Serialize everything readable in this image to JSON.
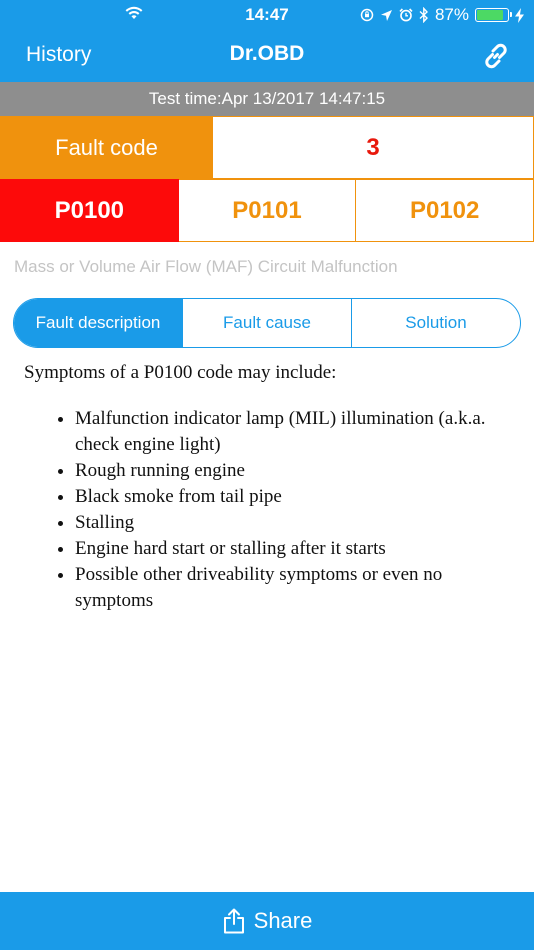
{
  "status_bar": {
    "time": "14:47",
    "battery_percent": "87%",
    "battery_level": 0.87,
    "icons": [
      "wifi-icon",
      "lock-rotation-icon",
      "location-icon",
      "alarm-icon",
      "bluetooth-icon",
      "battery-icon",
      "charging-icon"
    ]
  },
  "nav": {
    "back_label": "History",
    "title": "Dr.OBD",
    "link_icon": "link-icon"
  },
  "test_time": "Test time:Apr 13/2017 14:47:15",
  "fault": {
    "label": "Fault code",
    "count": "3",
    "codes": [
      "P0100",
      "P0101",
      "P0102"
    ],
    "selected_code": "P0100",
    "description_title": "Mass or Volume Air Flow (MAF) Circuit Malfunction"
  },
  "tabs": {
    "items": [
      "Fault description",
      "Fault cause",
      "Solution"
    ],
    "selected": "Fault description"
  },
  "content": {
    "intro": "Symptoms of a P0100 code may include:",
    "symptoms": [
      "Malfunction indicator lamp (MIL) illumination (a.k.a. check engine light)",
      "Rough running engine",
      "Black smoke from tail pipe",
      "Stalling",
      "Engine hard start or stalling after it starts",
      "Possible other driveability symptoms or even no symptoms"
    ]
  },
  "share": {
    "label": "Share",
    "icon": "share-icon"
  },
  "colors": {
    "accent_blue": "#1a9be8",
    "orange": "#f0920d",
    "red": "#fd0a0a",
    "count_red": "#e8180c",
    "gray_bar": "#8e8e8e"
  }
}
